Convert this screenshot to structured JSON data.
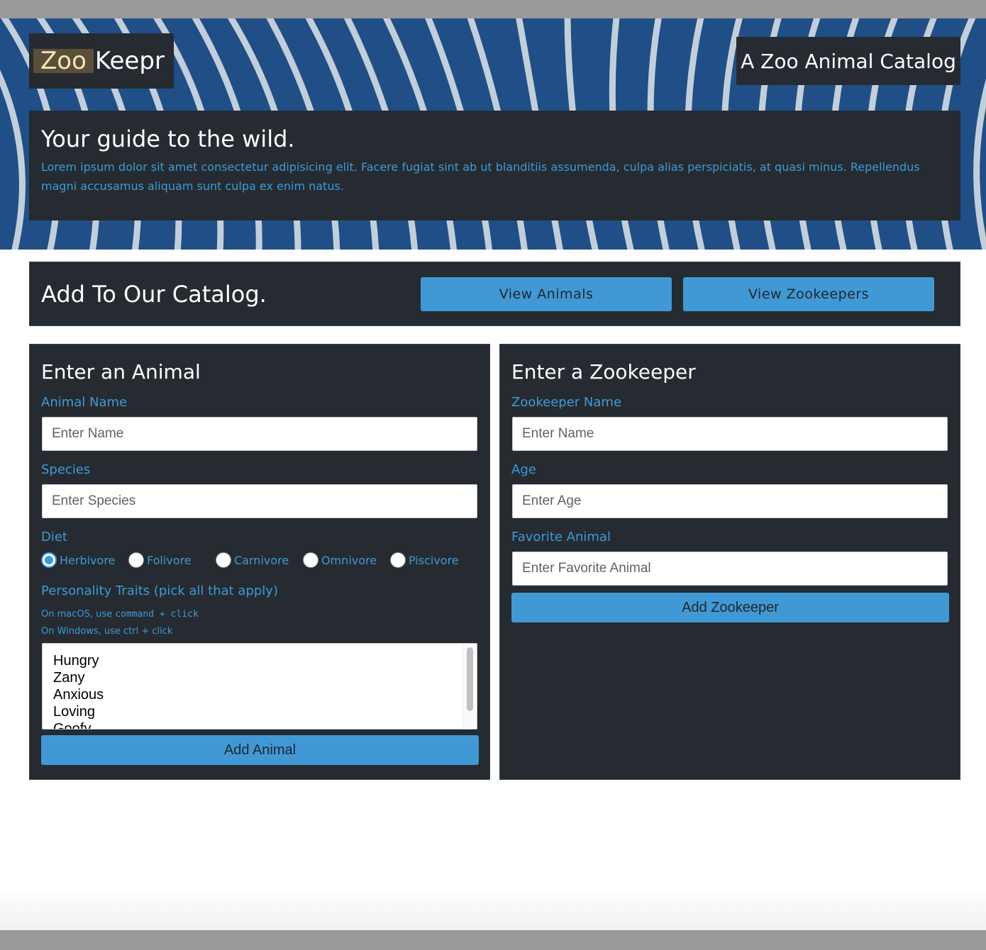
{
  "header": {
    "brand_highlight": "Zoo",
    "brand_rest": "Keepr",
    "tagline": "A Zoo Animal Catalog"
  },
  "hero": {
    "heading": "Your guide to the wild.",
    "body": "Lorem ipsum dolor sit amet consectetur adipisicing elit. Facere fugiat sint ab ut blanditiis assumenda, culpa alias perspiciatis, at quasi minus. Repellendus magni accusamus aliquam sunt culpa ex enim natus."
  },
  "catalog": {
    "heading": "Add To Our Catalog.",
    "view_animals": "View Animals",
    "view_zookeepers": "View Zookeepers"
  },
  "animal_form": {
    "title": "Enter an Animal",
    "name_label": "Animal Name",
    "name_placeholder": "Enter Name",
    "species_label": "Species",
    "species_placeholder": "Enter Species",
    "diet_label": "Diet",
    "diets": [
      {
        "label": "Herbivore",
        "checked": true
      },
      {
        "label": "Folivore",
        "checked": false
      },
      {
        "label": "Carnivore",
        "checked": false
      },
      {
        "label": "Omnivore",
        "checked": false
      },
      {
        "label": "Piscivore",
        "checked": false
      }
    ],
    "traits_label": "Personality Traits (pick all that apply)",
    "hint_mac_prefix": "On macOS, use ",
    "hint_mac_code": "command + click",
    "hint_windows": "On Windows, use ctrl + click",
    "traits": [
      "Hungry",
      "Zany",
      "Anxious",
      "Loving",
      "Goofy"
    ],
    "submit": "Add Animal"
  },
  "zookeeper_form": {
    "title": "Enter a Zookeeper",
    "name_label": "Zookeeper Name",
    "name_placeholder": "Enter Name",
    "age_label": "Age",
    "age_placeholder": "Enter Age",
    "favorite_label": "Favorite Animal",
    "favorite_placeholder": "Enter Favorite Animal",
    "submit": "Add Zookeeper"
  },
  "colors": {
    "panel": "#252b30",
    "accent": "#3e9ad9",
    "button": "#4099d5",
    "hero_blue": "#1f4f86"
  }
}
